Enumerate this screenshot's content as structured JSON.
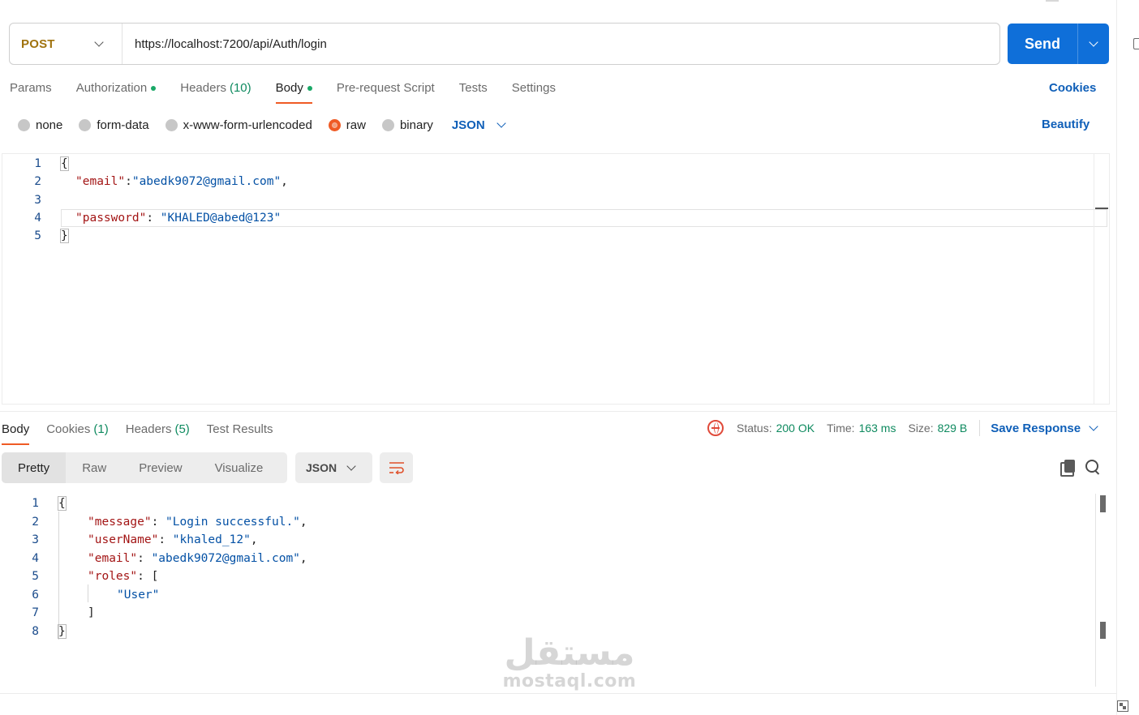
{
  "request": {
    "method": "POST",
    "url": "https://localhost:7200/api/Auth/login",
    "send_label": "Send",
    "tabs": [
      {
        "label": "Params"
      },
      {
        "label": "Authorization"
      },
      {
        "label": "Headers",
        "count": "(10)"
      },
      {
        "label": "Body"
      },
      {
        "label": "Pre-request Script"
      },
      {
        "label": "Tests"
      },
      {
        "label": "Settings"
      }
    ],
    "cookies_label": "Cookies",
    "body_types": [
      "none",
      "form-data",
      "x-www-form-urlencoded",
      "raw",
      "binary"
    ],
    "body_format": "JSON",
    "beautify_label": "Beautify",
    "body_lines": [
      {
        "n": "1",
        "text": "{"
      },
      {
        "n": "2",
        "key": "\"email\"",
        "sep": ":",
        "val": "\"abedk9072@gmail.com\"",
        "tail": ","
      },
      {
        "n": "3",
        "text": ""
      },
      {
        "n": "4",
        "key": "\"password\"",
        "sep": ": ",
        "val": "\"KHALED@abed@123\"",
        "tail": ""
      },
      {
        "n": "5",
        "text": "}"
      }
    ]
  },
  "response": {
    "tabs": [
      {
        "label": "Body"
      },
      {
        "label": "Cookies",
        "count": "(1)"
      },
      {
        "label": "Headers",
        "count": "(5)"
      },
      {
        "label": "Test Results"
      }
    ],
    "status_label": "Status:",
    "status_value": "200 OK",
    "time_label": "Time:",
    "time_value": "163 ms",
    "size_label": "Size:",
    "size_value": "829 B",
    "save_label": "Save Response",
    "views": [
      "Pretty",
      "Raw",
      "Preview",
      "Visualize"
    ],
    "format": "JSON",
    "lines": [
      {
        "n": "1",
        "text": "{"
      },
      {
        "n": "2",
        "key": "\"message\"",
        "val": "\"Login successful.\"",
        "tail": ","
      },
      {
        "n": "3",
        "key": "\"userName\"",
        "val": "\"khaled_12\"",
        "tail": ","
      },
      {
        "n": "4",
        "key": "\"email\"",
        "val": "\"abedk9072@gmail.com\"",
        "tail": ","
      },
      {
        "n": "5",
        "key": "\"roles\"",
        "val": "[",
        "tail": ""
      },
      {
        "n": "6",
        "text": "\"User\""
      },
      {
        "n": "7",
        "text": "]"
      },
      {
        "n": "8",
        "text": "}"
      }
    ]
  },
  "watermark": {
    "arabic": "مستقل",
    "latin": "mostaql.com"
  },
  "colors": {
    "accent": "#ef5b25",
    "send": "#0f6fd9",
    "link": "#0f5fb8",
    "success": "#0e8a5f",
    "method": "#a0730f"
  }
}
